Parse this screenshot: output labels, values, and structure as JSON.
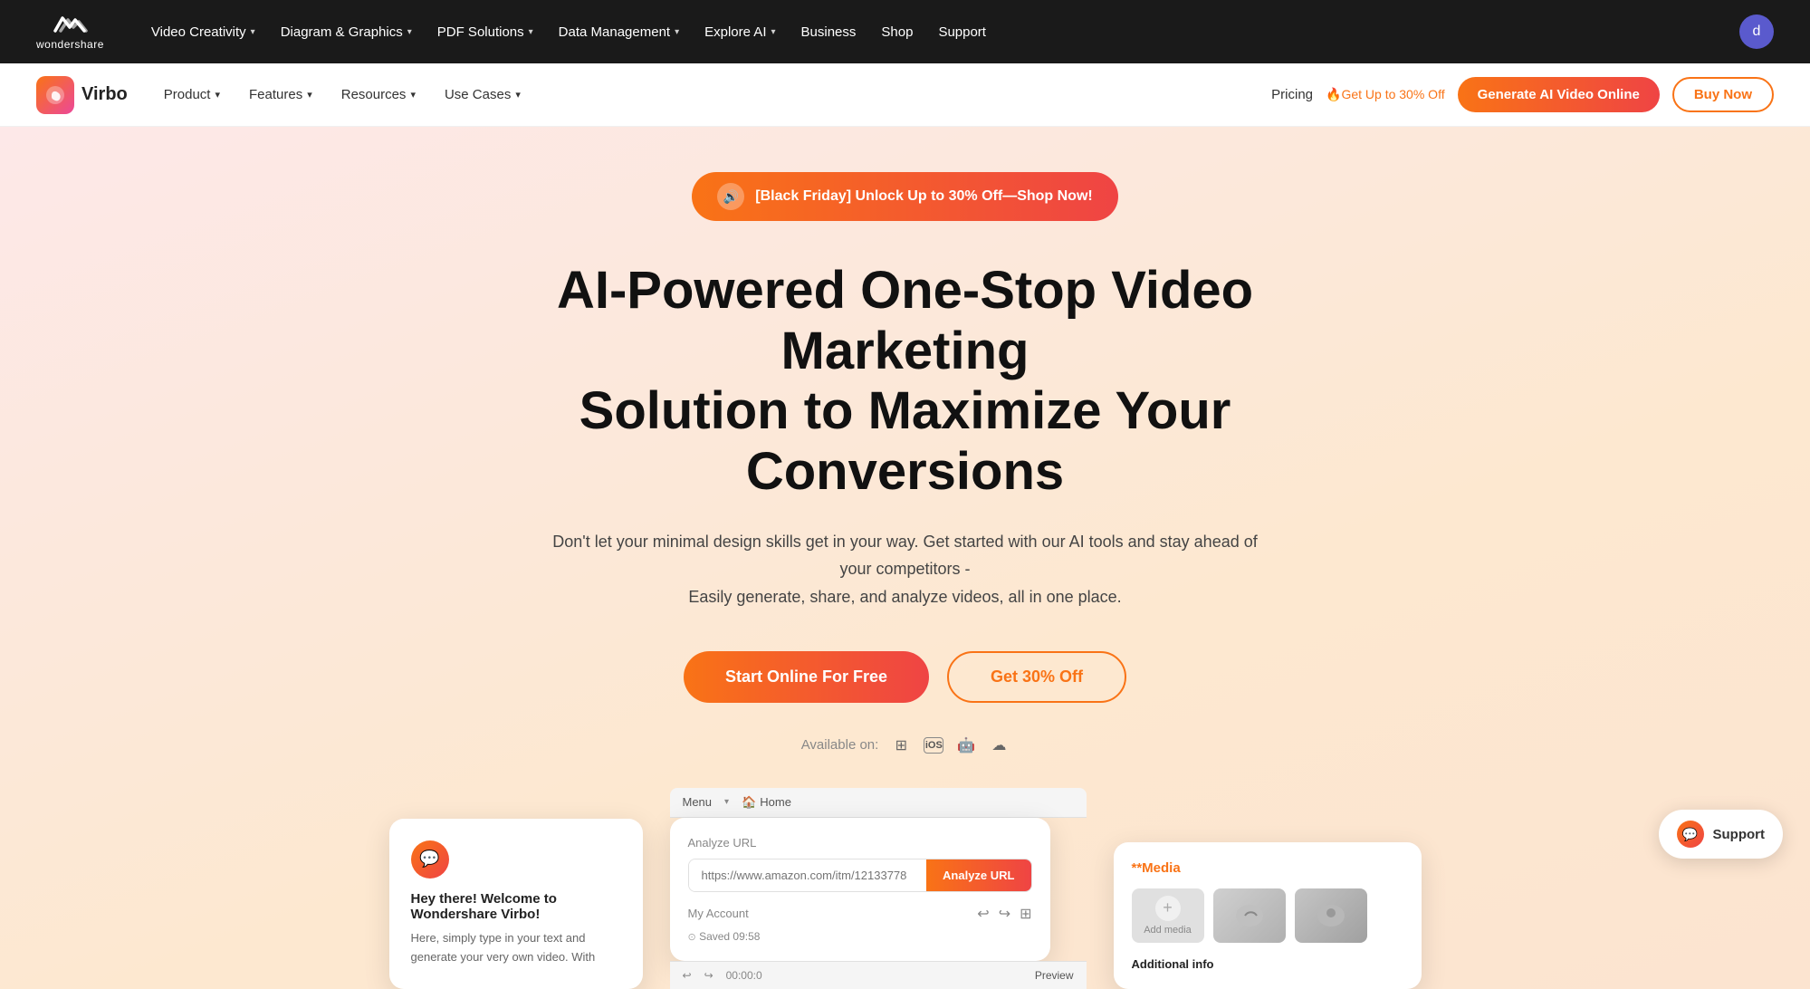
{
  "topNav": {
    "logo": "wondershare",
    "items": [
      {
        "label": "Video Creativity",
        "hasDropdown": true
      },
      {
        "label": "Diagram & Graphics",
        "hasDropdown": true
      },
      {
        "label": "PDF Solutions",
        "hasDropdown": true
      },
      {
        "label": "Data Management",
        "hasDropdown": true
      },
      {
        "label": "Explore AI",
        "hasDropdown": true
      },
      {
        "label": "Business"
      },
      {
        "label": "Shop"
      },
      {
        "label": "Support"
      }
    ],
    "avatarLetter": "d"
  },
  "secondaryNav": {
    "productName": "Virbo",
    "items": [
      {
        "label": "Product",
        "hasDropdown": true
      },
      {
        "label": "Features",
        "hasDropdown": true
      },
      {
        "label": "Resources",
        "hasDropdown": true
      },
      {
        "label": "Use Cases",
        "hasDropdown": true
      }
    ],
    "pricing": "Pricing",
    "promoBadge": "🔥Get Up to 30% Off",
    "btnGenerate": "Generate AI Video Online",
    "btnBuy": "Buy Now"
  },
  "hero": {
    "blackFriday": "[Black Friday]  Unlock Up to 30% Off—Shop Now!",
    "title": "AI-Powered One-Stop Video Marketing\nSolution to Maximize Your Conversions",
    "subtitle": "Don't let your minimal design skills get in your way. Get started with our AI tools and stay ahead of your competitors -\nEasily generate, share, and analyze videos, all in one place.",
    "btnStart": "Start Online For Free",
    "btnDiscount": "Get 30% Off",
    "availableOn": "Available on:",
    "platforms": [
      "windows",
      "ios",
      "android",
      "cloud"
    ]
  },
  "chatCard": {
    "title": "Hey there! Welcome to Wondershare Virbo!",
    "body": "Here, simply type in your text and generate your very own video. With"
  },
  "analyzeCard": {
    "label": "Analyze URL",
    "placeholder": "https://www.amazon.com/itm/12133778",
    "btnLabel": "Analyze URL",
    "menu": "Menu",
    "home": "Home",
    "myAccount": "My Account",
    "saved": "Saved 09:58"
  },
  "mediaCard": {
    "starLabel": "*Media",
    "addMediaLabel": "Add media",
    "additionalInfo": "Additional info"
  },
  "support": {
    "label": "Support"
  },
  "bottomBar": {
    "myAccount": "My Account",
    "undo": "↩",
    "redo": "↪",
    "time": "00:00:0",
    "preview": "Preview"
  }
}
